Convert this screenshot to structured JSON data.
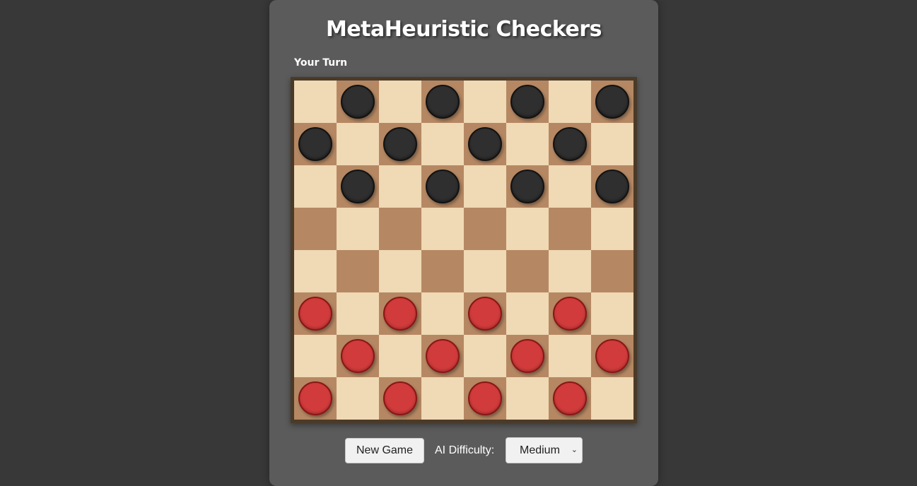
{
  "title": "MetaHeuristic Checkers",
  "status": "Your Turn",
  "board": {
    "size": 8,
    "light_color": "#f0d9b5",
    "dark_color": "#b58863",
    "black_piece_color": "#2f2f2f",
    "red_piece_color": "#d13b3b",
    "rows": [
      "-b-b-b-b",
      "b-b-b-b-",
      "-b-b-b-b",
      "--------",
      "--------",
      "r-r-r-r-",
      "-r-r-r-r",
      "r-r-r-r-"
    ]
  },
  "controls": {
    "new_game_label": "New Game",
    "difficulty_label": "AI Difficulty:",
    "difficulty_value": "Medium",
    "chevron_icon": "chevron-down-icon"
  }
}
